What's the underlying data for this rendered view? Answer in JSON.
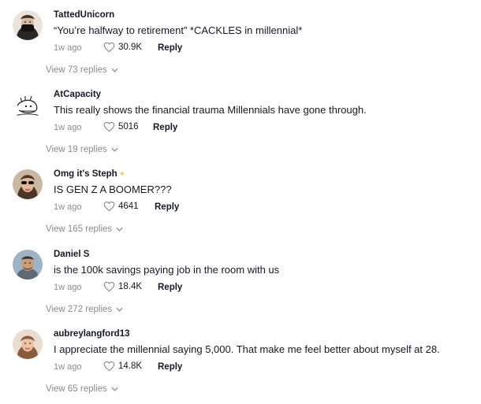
{
  "comments": [
    {
      "username": "TattedUnicorn",
      "text": "“You’re halfway to retirement” *CACKLES in millennial*",
      "time": "1w ago",
      "likes": "30.9K",
      "reply_label": "Reply",
      "view_replies": "View 73 replies",
      "avatar_icon": "avatar-masked-person-icon"
    },
    {
      "username": "AtCapacity",
      "text": "This really shows the financial trauma Millennials have gone through.",
      "time": "1w ago",
      "likes": "5016",
      "reply_label": "Reply",
      "view_replies": "View 19 replies",
      "avatar_icon": "avatar-sketch-icon"
    },
    {
      "username": "Omg it's Steph",
      "badge_icon": "sparkle-icon",
      "text": "IS GEN Z A BOOMER???",
      "time": "1w ago",
      "likes": "4641",
      "reply_label": "Reply",
      "view_replies": "View 165 replies",
      "avatar_icon": "avatar-woman-sunglasses-icon"
    },
    {
      "username": "Daniel S",
      "text": "is the 100k savings paying job in the room with us",
      "time": "1w ago",
      "likes": "18.4K",
      "reply_label": "Reply",
      "view_replies": "View 272 replies",
      "avatar_icon": "avatar-man-icon"
    },
    {
      "username": "aubreylangford13",
      "text": "I appreciate the millennial saying 5,000. That make me feel better about myself at 28.",
      "time": "1w ago",
      "likes": "14.8K",
      "reply_label": "Reply",
      "view_replies": "View 65 replies",
      "avatar_icon": "avatar-woman-icon"
    }
  ],
  "colors": {
    "text_primary": "#161823",
    "text_secondary": "#8a8b91",
    "sparkle": "#f5c84c"
  }
}
